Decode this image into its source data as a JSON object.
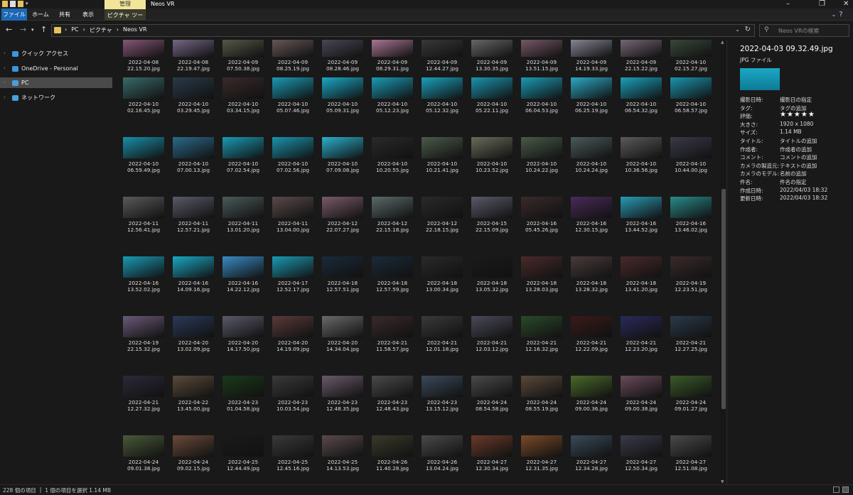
{
  "window": {
    "title": "Neos VR",
    "context_tab": "管理"
  },
  "ribbon": {
    "tabs": [
      "ファイル",
      "ホーム",
      "共有",
      "表示"
    ],
    "context_label": "ピクチャ ツール"
  },
  "address": {
    "crumbs": [
      "PC",
      "ピクチャ",
      "Neos VR"
    ]
  },
  "search": {
    "placeholder": "Neos VRの検索"
  },
  "nav": [
    {
      "label": "クイック アクセス",
      "color": "#3a96dd",
      "selected": false
    },
    {
      "label": "OneDrive - Personal",
      "color": "#3a96dd",
      "selected": false
    },
    {
      "label": "PC",
      "color": "#4a9fd8",
      "selected": true
    },
    {
      "label": "ネットワーク",
      "color": "#4a9fd8",
      "selected": false
    }
  ],
  "files": [
    {
      "date": "2022-04-08",
      "time": "22.15.20.jpg",
      "color": "#8a5a7a"
    },
    {
      "date": "2022-04-08",
      "time": "22.19.47.jpg",
      "color": "#7a6a8a"
    },
    {
      "date": "2022-04-09",
      "time": "07.50.38.jpg",
      "color": "#5a5a4a"
    },
    {
      "date": "2022-04-09",
      "time": "08.25.19.jpg",
      "color": "#6a5a5a"
    },
    {
      "date": "2022-04-09",
      "time": "08.28.46.jpg",
      "color": "#4a4a5a"
    },
    {
      "date": "2022-04-09",
      "time": "08.29.31.jpg",
      "color": "#b07a9a"
    },
    {
      "date": "2022-04-09",
      "time": "12.44.27.jpg",
      "color": "#3a3a3a"
    },
    {
      "date": "2022-04-09",
      "time": "13.30.35.jpg",
      "color": "#6a6a6a"
    },
    {
      "date": "2022-04-09",
      "time": "13.51.15.jpg",
      "color": "#7a5a6a"
    },
    {
      "date": "2022-04-09",
      "time": "14.19.33.jpg",
      "color": "#8a8a9a"
    },
    {
      "date": "2022-04-09",
      "time": "22.15.22.jpg",
      "color": "#7a6a7a"
    },
    {
      "date": "2022-04-10",
      "time": "02.15.27.jpg",
      "color": "#3a4a3a"
    },
    {
      "date": "2022-04-10",
      "time": "02.16.45.jpg",
      "color": "#3a6a6a"
    },
    {
      "date": "2022-04-10",
      "time": "03.29.45.jpg",
      "color": "#2a3a4a"
    },
    {
      "date": "2022-04-10",
      "time": "03.34.15.jpg",
      "color": "#3a2a2a"
    },
    {
      "date": "2022-04-10",
      "time": "05.07.46.jpg",
      "color": "#1a9ab4"
    },
    {
      "date": "2022-04-10",
      "time": "05.09.31.jpg",
      "color": "#1aa8c4"
    },
    {
      "date": "2022-04-10",
      "time": "05.12.23.jpg",
      "color": "#1a9ab4"
    },
    {
      "date": "2022-04-10",
      "time": "05.12.32.jpg",
      "color": "#1aa0ba"
    },
    {
      "date": "2022-04-10",
      "time": "05.22.11.jpg",
      "color": "#1a94ae"
    },
    {
      "date": "2022-04-10",
      "time": "06.04.53.jpg",
      "color": "#1a9ab4"
    },
    {
      "date": "2022-04-10",
      "time": "06.25.19.jpg",
      "color": "#2aa8c4"
    },
    {
      "date": "2022-04-10",
      "time": "06.54.32.jpg",
      "color": "#1aa0ba"
    },
    {
      "date": "2022-04-10",
      "time": "06.58.57.jpg",
      "color": "#1a94ae"
    },
    {
      "date": "2022-04-10",
      "time": "06.59.49.jpg",
      "color": "#1a8ea8"
    },
    {
      "date": "2022-04-10",
      "time": "07.00.13.jpg",
      "color": "#2a6a8a"
    },
    {
      "date": "2022-04-10",
      "time": "07.02.54.jpg",
      "color": "#1a9ab4"
    },
    {
      "date": "2022-04-10",
      "time": "07.02.56.jpg",
      "color": "#1a94ae"
    },
    {
      "date": "2022-04-10",
      "time": "07.09.08.jpg",
      "color": "#2ab0cc"
    },
    {
      "date": "2022-04-10",
      "time": "10.20.55.jpg",
      "color": "#2a2a2a"
    },
    {
      "date": "2022-04-10",
      "time": "10.21.41.jpg",
      "color": "#4a5a4a"
    },
    {
      "date": "2022-04-10",
      "time": "10.23.52.jpg",
      "color": "#6a6a5a"
    },
    {
      "date": "2022-04-10",
      "time": "10.24.22.jpg",
      "color": "#4a5a4a"
    },
    {
      "date": "2022-04-10",
      "time": "10.24.24.jpg",
      "color": "#4a5a5a"
    },
    {
      "date": "2022-04-10",
      "time": "10.36.56.jpg",
      "color": "#5a5a5a"
    },
    {
      "date": "2022-04-10",
      "time": "10.44.00.jpg",
      "color": "#3a3a4a"
    },
    {
      "date": "2022-04-11",
      "time": "12.56.41.jpg",
      "color": "#5a5a5a"
    },
    {
      "date": "2022-04-11",
      "time": "12.57.21.jpg",
      "color": "#5a5a6a"
    },
    {
      "date": "2022-04-11",
      "time": "13.01.20.jpg",
      "color": "#4a5a5a"
    },
    {
      "date": "2022-04-11",
      "time": "13.04.00.jpg",
      "color": "#5a4a4a"
    },
    {
      "date": "2022-04-12",
      "time": "22.07.27.jpg",
      "color": "#7a5a6a"
    },
    {
      "date": "2022-04-12",
      "time": "22.15.18.jpg",
      "color": "#5a6a6a"
    },
    {
      "date": "2022-04-12",
      "time": "22.18.15.jpg",
      "color": "#2a2a2a"
    },
    {
      "date": "2022-04-15",
      "time": "22.15.09.jpg",
      "color": "#5a5a6a"
    },
    {
      "date": "2022-04-16",
      "time": "05.45.26.jpg",
      "color": "#3a2a2a"
    },
    {
      "date": "2022-04-16",
      "time": "12.30.15.jpg",
      "color": "#4a2a5a"
    },
    {
      "date": "2022-04-16",
      "time": "13.44.52.jpg",
      "color": "#2a9ab4"
    },
    {
      "date": "2022-04-16",
      "time": "13.46.02.jpg",
      "color": "#2a8a8a"
    },
    {
      "date": "2022-04-16",
      "time": "13.52.02.jpg",
      "color": "#1a9ab4"
    },
    {
      "date": "2022-04-16",
      "time": "14.09.16.jpg",
      "color": "#1aa8c4"
    },
    {
      "date": "2022-04-16",
      "time": "14.22.12.jpg",
      "color": "#3a8ac4"
    },
    {
      "date": "2022-04-17",
      "time": "12.52.17.jpg",
      "color": "#1a9ab4"
    },
    {
      "date": "2022-04-18",
      "time": "12.57.51.jpg",
      "color": "#1a2a3a"
    },
    {
      "date": "2022-04-18",
      "time": "12.57.59.jpg",
      "color": "#1a2a3a"
    },
    {
      "date": "2022-04-18",
      "time": "13.00.34.jpg",
      "color": "#2a2a2a"
    },
    {
      "date": "2022-04-18",
      "time": "13.05.32.jpg",
      "color": "#1a1a1a"
    },
    {
      "date": "2022-04-18",
      "time": "13.28.03.jpg",
      "color": "#4a2a2a"
    },
    {
      "date": "2022-04-18",
      "time": "13.28.32.jpg",
      "color": "#4a3a3a"
    },
    {
      "date": "2022-04-18",
      "time": "13.41.20.jpg",
      "color": "#4a2a2a"
    },
    {
      "date": "2022-04-19",
      "time": "12.23.51.jpg",
      "color": "#3a2a2a"
    },
    {
      "date": "2022-04-19",
      "time": "22.15.32.jpg",
      "color": "#6a5a7a"
    },
    {
      "date": "2022-04-20",
      "time": "13.02.09.jpg",
      "color": "#2a3a5a"
    },
    {
      "date": "2022-04-20",
      "time": "14.17.50.jpg",
      "color": "#5a5a6a"
    },
    {
      "date": "2022-04-20",
      "time": "14.19.09.jpg",
      "color": "#5a3a3a"
    },
    {
      "date": "2022-04-20",
      "time": "14.34.04.jpg",
      "color": "#6a6a6a"
    },
    {
      "date": "2022-04-21",
      "time": "11.58.57.jpg",
      "color": "#3a2a2a"
    },
    {
      "date": "2022-04-21",
      "time": "12.01.18.jpg",
      "color": "#3a3a3a"
    },
    {
      "date": "2022-04-21",
      "time": "12.03.12.jpg",
      "color": "#4a4a5a"
    },
    {
      "date": "2022-04-21",
      "time": "12.16.32.jpg",
      "color": "#2a4a2a"
    },
    {
      "date": "2022-04-21",
      "time": "12.22.09.jpg",
      "color": "#3a1a1a"
    },
    {
      "date": "2022-04-21",
      "time": "12.23.20.jpg",
      "color": "#2a2a5a"
    },
    {
      "date": "2022-04-21",
      "time": "12.27.25.jpg",
      "color": "#2a3a4a"
    },
    {
      "date": "2022-04-21",
      "time": "12.27.32.jpg",
      "color": "#2a2a3a"
    },
    {
      "date": "2022-04-22",
      "time": "13.45.00.jpg",
      "color": "#5a4a3a"
    },
    {
      "date": "2022-04-23",
      "time": "01.04.58.jpg",
      "color": "#1a3a1a"
    },
    {
      "date": "2022-04-23",
      "time": "10.03.54.jpg",
      "color": "#3a3a3a"
    },
    {
      "date": "2022-04-23",
      "time": "12.48.35.jpg",
      "color": "#6a5a6a"
    },
    {
      "date": "2022-04-23",
      "time": "12.48.43.jpg",
      "color": "#4a4a4a"
    },
    {
      "date": "2022-04-23",
      "time": "13.15.12.jpg",
      "color": "#3a4a5a"
    },
    {
      "date": "2022-04-24",
      "time": "08.54.58.jpg",
      "color": "#4a4a4a"
    },
    {
      "date": "2022-04-24",
      "time": "08.55.19.jpg",
      "color": "#5a4a3a"
    },
    {
      "date": "2022-04-24",
      "time": "09.00.36.jpg",
      "color": "#4a6a2a"
    },
    {
      "date": "2022-04-24",
      "time": "09.00.38.jpg",
      "color": "#6a4a5a"
    },
    {
      "date": "2022-04-24",
      "time": "09.01.27.jpg",
      "color": "#3a5a2a"
    },
    {
      "date": "2022-04-24",
      "time": "09.01.38.jpg",
      "color": "#4a5a3a"
    },
    {
      "date": "2022-04-24",
      "time": "09.02.15.jpg",
      "color": "#6a4a3a"
    },
    {
      "date": "2022-04-25",
      "time": "12.44.49.jpg",
      "color": "#1a1a1a"
    },
    {
      "date": "2022-04-25",
      "time": "12.45.16.jpg",
      "color": "#3a3a3a"
    },
    {
      "date": "2022-04-25",
      "time": "14.13.53.jpg",
      "color": "#5a4a4a"
    },
    {
      "date": "2022-04-26",
      "time": "11.40.28.jpg",
      "color": "#3a3a2a"
    },
    {
      "date": "2022-04-26",
      "time": "13.04.24.jpg",
      "color": "#4a4a4a"
    },
    {
      "date": "2022-04-27",
      "time": "12.30.34.jpg",
      "color": "#6a3a2a"
    },
    {
      "date": "2022-04-27",
      "time": "12.31.35.jpg",
      "color": "#7a4a2a"
    },
    {
      "date": "2022-04-27",
      "time": "12.34.28.jpg",
      "color": "#3a4a5a"
    },
    {
      "date": "2022-04-27",
      "time": "12.50.34.jpg",
      "color": "#3a3a4a"
    },
    {
      "date": "2022-04-27",
      "time": "12.51.08.jpg",
      "color": "#4a4a4a"
    }
  ],
  "details": {
    "title": "2022-04-03 09.32.49.jpg",
    "type": "JPG ファイル",
    "rating": 5,
    "props": [
      {
        "k": "撮影日時:",
        "v": "撮影日の指定"
      },
      {
        "k": "タグ:",
        "v": "タグの追加"
      },
      {
        "k": "評価:",
        "v": ""
      },
      {
        "k": "大きさ:",
        "v": "1920 x 1080"
      },
      {
        "k": "サイズ:",
        "v": "1.14 MB"
      },
      {
        "k": "タイトル:",
        "v": "タイトルの追加"
      },
      {
        "k": "作成者:",
        "v": "作成者の追加"
      },
      {
        "k": "コメント:",
        "v": "コメントの追加"
      },
      {
        "k": "カメラの製造元:",
        "v": "テキストの追加"
      },
      {
        "k": "カメラのモデル:",
        "v": "名前の追加"
      },
      {
        "k": "件名:",
        "v": "件名の指定"
      },
      {
        "k": "作成日時:",
        "v": "2022/04/03 18:32"
      },
      {
        "k": "更新日時:",
        "v": "2022/04/03 18:32"
      }
    ]
  },
  "status": {
    "count": "228 個の項目",
    "selected": "1 個の項目を選択 1.14 MB"
  }
}
